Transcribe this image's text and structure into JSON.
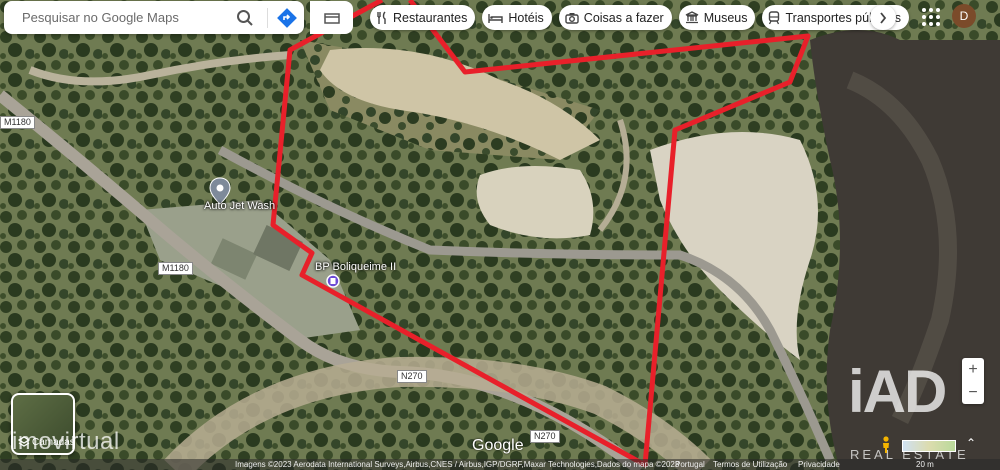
{
  "search": {
    "placeholder": "Pesquisar no Google Maps"
  },
  "categories": [
    "Restaurantes",
    "Hotéis",
    "Coisas a fazer",
    "Museus",
    "Transportes públicos"
  ],
  "user": {
    "initial": "D"
  },
  "map": {
    "road_labels": [
      "M1180",
      "M1180",
      "N270",
      "N270"
    ],
    "places": [
      "Auto Jet Wash",
      "BP Boliqueime II"
    ],
    "layers_label": "Camadas",
    "google_label": "Google",
    "attribution": "Imagens ©2023 Aerodata International Surveys,Airbus,CNES / Airbus,IGP/DGRF,Maxar Technologies,Dados do mapa ©2023",
    "footer_links": [
      "Portugal",
      "Termos de Utilização",
      "Privacidade"
    ],
    "scale": "20 m"
  },
  "watermarks": {
    "left": "imovirtual",
    "right": "iAD",
    "right_sub": "REAL ESTATE"
  },
  "colors": {
    "boundary": "#e8202a",
    "accent": "#1a73e8"
  }
}
